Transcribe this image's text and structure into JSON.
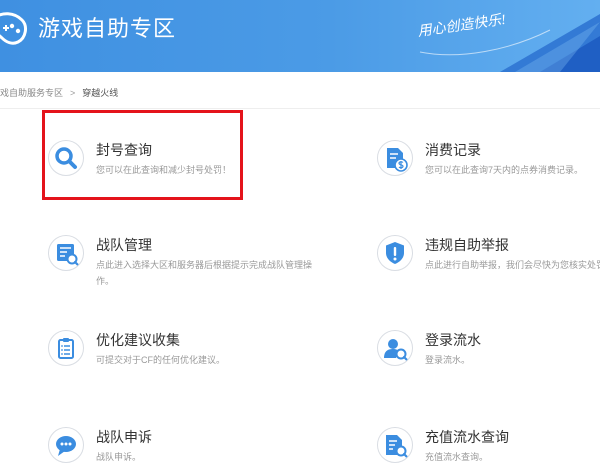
{
  "header": {
    "logo_icon": "gamepad-logo-icon",
    "title": "游戏自助专区",
    "slogan": "用心创造快乐!"
  },
  "breadcrumb": {
    "items": [
      "戏自助服务专区",
      "穿越火线"
    ],
    "separator": ">"
  },
  "services": [
    {
      "icon": "search-icon",
      "title": "封号查询",
      "desc": "您可以在此查询和减少封号处罚！"
    },
    {
      "icon": "consumption-record-icon",
      "title": "消费记录",
      "desc": "您可以在此查询7天内的点券消费记录。"
    },
    {
      "icon": "team-management-icon",
      "title": "战队管理",
      "desc": "点此进入选择大区和服务器后根据提示完成战队管理操作。"
    },
    {
      "icon": "report-shield-icon",
      "title": "违规自助举报",
      "desc": "点此进行自助举报，我们会尽快为您核实处罚"
    },
    {
      "icon": "suggestion-clipboard-icon",
      "title": "优化建议收集",
      "desc": "可提交对于CF的任何优化建议。"
    },
    {
      "icon": "login-record-icon",
      "title": "登录流水",
      "desc": "登录流水。"
    },
    {
      "icon": "chat-bubble-icon",
      "title": "战队申诉",
      "desc": "战队申诉。"
    },
    {
      "icon": "recharge-record-icon",
      "title": "充值流水查询",
      "desc": "充值流水查询。"
    }
  ],
  "colors": {
    "header_blue": "#4b9be6",
    "header_accent": "#2563c9",
    "icon_blue": "#3b8de0",
    "highlight_red": "#e4131b",
    "title_text": "#333333",
    "desc_text": "#999999"
  }
}
